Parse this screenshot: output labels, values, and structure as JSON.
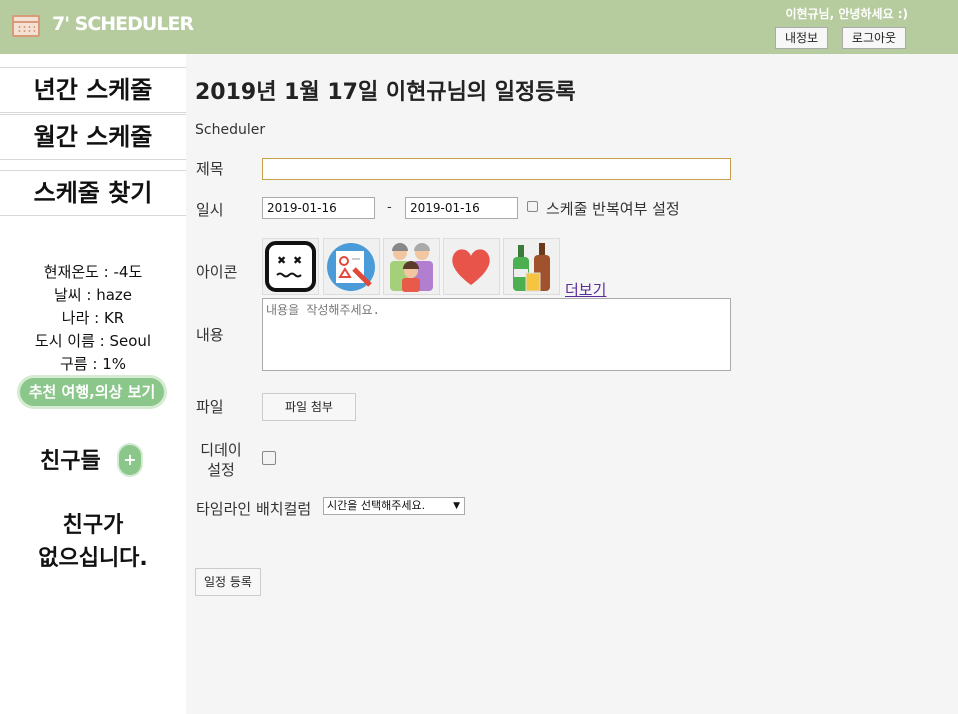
{
  "header": {
    "app_title": "7' SCHEDULER",
    "greeting": "이현규님, 안녕하세요 :)",
    "my_info_label": "내정보",
    "logout_label": "로그아웃",
    "accent_color": "#b6cc9e"
  },
  "sidebar": {
    "nav": [
      "년간 스케줄",
      "월간 스케줄",
      "스케줄 찾기"
    ],
    "weather": {
      "temperature": "현재온도 : -4도",
      "condition": "날씨 : haze",
      "country": "나라 : KR",
      "city": "도시 이름 : Seoul",
      "cloud": "구름 : 1%"
    },
    "recommend_button": "추천 여행,의상 보기",
    "friends_title": "친구들",
    "add_friend_label": "+",
    "no_friends_line1": "친구가",
    "no_friends_line2": "없으십니다."
  },
  "form": {
    "page_title": "2019년 1월 17일 이현규님의 일정등록",
    "subheading": "Scheduler",
    "title_label": "제목",
    "title_value": "",
    "date_label": "일시",
    "start_date": "2019-01-16",
    "date_separator": "-",
    "end_date": "2019-01-16",
    "repeat_label": "스케줄 반복여부 설정",
    "icon_label": "아이콘",
    "icons": [
      "dizzy-face-icon",
      "certificate-icon",
      "family-icon",
      "heart-icon",
      "bottles-icon"
    ],
    "more_link": "더보기",
    "content_label": "내용",
    "content_placeholder": "내용을 작성해주세요.",
    "file_label": "파일",
    "file_button": "파일 첨부",
    "dday_label_line1": "디데이",
    "dday_label_line2": "설정",
    "timeline_label": "타임라인 배치컬럼",
    "timeline_selected": "시간을 선택해주세요.",
    "submit_button": "일정 등록"
  }
}
